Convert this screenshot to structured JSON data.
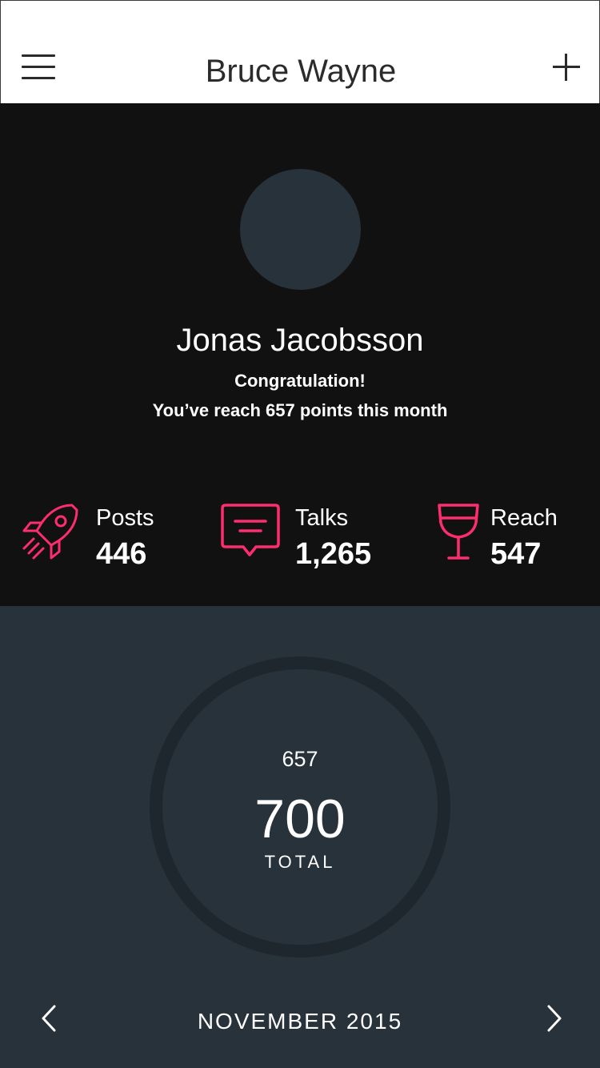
{
  "header": {
    "title": "Bruce Wayne",
    "menu_icon": "hamburger-menu-icon",
    "add_icon": "plus-icon"
  },
  "profile": {
    "name": "Jonas Jacobsson",
    "congrats": "Congratulation!",
    "message": "You’ve reach 657 points this month"
  },
  "stats": [
    {
      "label": "Posts",
      "value": "446",
      "icon": "rocket-icon"
    },
    {
      "label": "Talks",
      "value": "1,265",
      "icon": "chat-bubble-icon"
    },
    {
      "label": "Reach",
      "value": "547",
      "icon": "wine-glass-icon"
    }
  ],
  "summary": {
    "current": "657",
    "total": "700",
    "total_label": "TOTAL",
    "month": "NOVEMBER 2015",
    "prev_icon": "chevron-left-icon",
    "next_icon": "chevron-right-icon"
  },
  "colors": {
    "accent": "#ff2d6f",
    "header_bg": "#ffffff",
    "profile_bg": "#111111",
    "summary_bg": "#27323a",
    "ring": "#1d272d"
  }
}
